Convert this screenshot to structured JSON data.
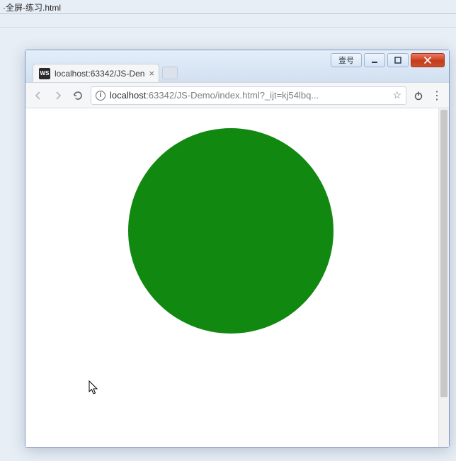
{
  "desktop": {
    "file_label": "·全屏-练习.html"
  },
  "titlebar": {
    "extra_button_text": "壹号"
  },
  "browser": {
    "tab": {
      "favicon_text": "WS",
      "title": "localhost:63342/JS-Den"
    },
    "address": {
      "site_info_glyph": "i",
      "host": "localhost",
      "rest": ":63342/JS-Demo/index.html?_ijt=kj54lbq..."
    },
    "icons": {
      "star": "☆",
      "power": "⏻",
      "menu": "⋮"
    }
  },
  "content": {
    "circle_color": "#118911"
  }
}
